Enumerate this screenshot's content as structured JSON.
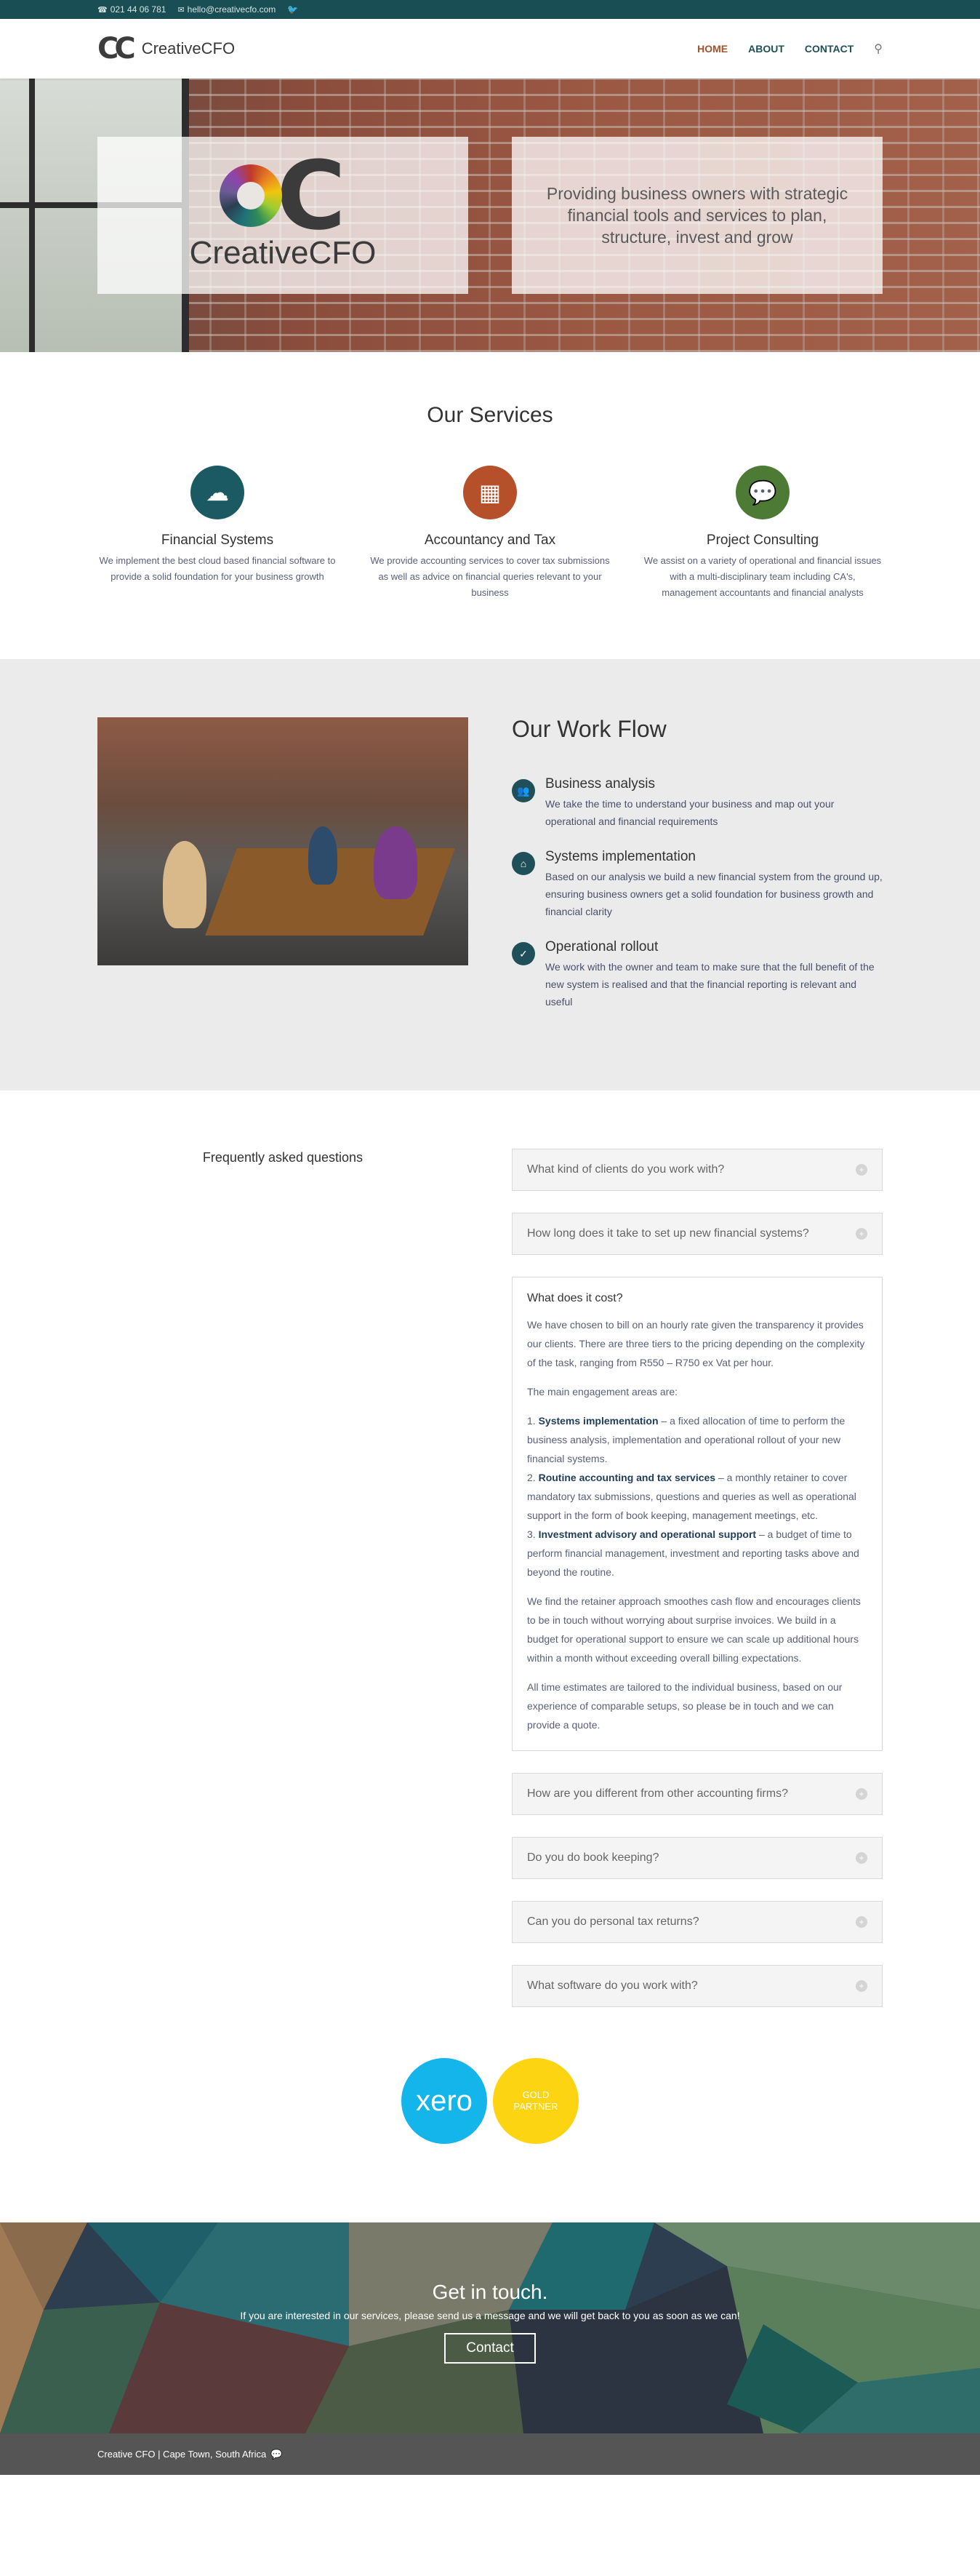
{
  "topbar": {
    "phone": "021 44 06 781",
    "email": "hello@creativecfo.com",
    "twitter_icon": "twitter-icon"
  },
  "header": {
    "logo_text": "CreativeCFO",
    "nav": [
      {
        "label": "HOME",
        "active": true
      },
      {
        "label": "ABOUT"
      },
      {
        "label": "CONTACT"
      }
    ],
    "search_icon": "search-icon"
  },
  "hero": {
    "logo_name": "CreativeCFO",
    "tagline": "Providing business owners with strategic financial tools and services to plan, structure, invest and grow"
  },
  "services": {
    "title": "Our Services",
    "items": [
      {
        "title": "Financial Systems",
        "text": "We implement the best cloud based financial software to provide a solid foundation for your business growth",
        "color": "#1c5a63",
        "icon": "cloud-sun-icon"
      },
      {
        "title": "Accountancy and Tax",
        "text": "We provide accounting services to cover tax submissions as well as advice on financial queries relevant to your business",
        "color": "#b5502a",
        "icon": "boxes-icon"
      },
      {
        "title": "Project Consulting",
        "text": "We assist on a variety of operational and financial issues with a multi-disciplinary team including CA's, management accountants and financial analysts",
        "color": "#4d7a34",
        "icon": "chat-bubbles-icon"
      }
    ]
  },
  "workflow": {
    "title": "Our Work Flow",
    "steps": [
      {
        "title": "Business analysis",
        "text": "We take the time to understand your business and map out your operational and financial requirements",
        "icon": "users-icon"
      },
      {
        "title": "Systems implementation",
        "text": "Based on our analysis we build a new financial system from the ground up, ensuring business owners get a solid foundation for business growth and financial clarity",
        "icon": "home-icon"
      },
      {
        "title": "Operational rollout",
        "text": "We work with the owner and team to make sure that the full benefit of the new system is realised and that the financial reporting is relevant and useful",
        "icon": "check-circle-icon"
      }
    ]
  },
  "faq": {
    "heading": "Frequently asked questions",
    "q1": "What kind of clients do you work with?",
    "q2": "How long does it take to set up new financial systems?",
    "open": {
      "title": "What does it cost?",
      "p1": "We have chosen to bill on an hourly rate given the transparency it provides our clients. There are three tiers to the pricing depending on the complexity of the task, ranging from R550 – R750 ex Vat per hour.",
      "p2": "The main engagement areas are:",
      "a1_b": "Systems implementation",
      "a1": " – a fixed allocation of time to perform the business analysis, implementation and operational rollout of your new financial systems.",
      "a2_b": "Routine accounting and tax services",
      "a2": " – a monthly retainer to cover mandatory tax submissions, questions and queries as well as operational support in the form of book keeping, management meetings, etc.",
      "a3_b": "Investment advisory and operational support",
      "a3": " – a budget of time to perform financial management, investment and reporting tasks above and beyond the routine.",
      "p3": "We find the retainer approach smoothes cash flow and encourages clients to be in touch without worrying about surprise invoices. We build in a budget for operational support to ensure we can scale up additional hours within a month without exceeding overall billing expectations.",
      "p4": "All time estimates are tailored to the individual business, based on our experience of comparable setups, so please be in touch and we can provide a quote."
    },
    "q3": "How are you different from other accounting firms?",
    "q4": "Do you do book keeping?",
    "q5": "Can you do personal tax returns?",
    "q6": "What software do you work with?"
  },
  "partner": {
    "xero": "xero",
    "gold_line1": "GOLD",
    "gold_line2": "PARTNER"
  },
  "contact": {
    "title": "Get in touch.",
    "text": "If you are interested in our services, please send us a message and we will get back to you as soon as we can!",
    "button": "Contact"
  },
  "footer": {
    "text": "Creative CFO | Cape Town, South Africa",
    "icon": "chat-icon"
  }
}
